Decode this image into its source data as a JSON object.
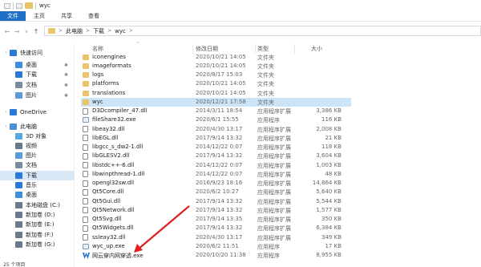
{
  "window": {
    "title": "wyc"
  },
  "ribbon": {
    "tabs": [
      "文件",
      "主页",
      "共享",
      "查看"
    ]
  },
  "address": {
    "crumbs": [
      "此电脑",
      "下载",
      "wyc"
    ],
    "separator": ">"
  },
  "nav": {
    "back": "←",
    "forward": "→",
    "recent": "∨",
    "up": "↑"
  },
  "sidebar": {
    "items": [
      {
        "label": "快速访问",
        "icon": "star-icon",
        "color": "#2b79d6"
      },
      {
        "label": "桌面",
        "icon": "desktop-icon",
        "color": "#3b8fdc",
        "pinned": true
      },
      {
        "label": "下载",
        "icon": "download-icon",
        "color": "#2b79d6",
        "pinned": true
      },
      {
        "label": "文档",
        "icon": "documents-icon",
        "color": "#7a8aa0",
        "pinned": true
      },
      {
        "label": "图片",
        "icon": "pictures-icon",
        "color": "#5a9bd8",
        "pinned": true
      },
      {
        "label": "OneDrive",
        "icon": "cloud-icon",
        "color": "#2b79d6"
      },
      {
        "label": "此电脑",
        "icon": "computer-icon",
        "color": "#4a8fd4"
      },
      {
        "label": "3D 对象",
        "icon": "cube-icon",
        "color": "#58a6e0"
      },
      {
        "label": "视频",
        "icon": "video-icon",
        "color": "#6a7a8c"
      },
      {
        "label": "图片",
        "icon": "pictures-icon",
        "color": "#5a9bd8"
      },
      {
        "label": "文档",
        "icon": "documents-icon",
        "color": "#7a8aa0"
      },
      {
        "label": "下载",
        "icon": "download-icon",
        "color": "#2b79d6",
        "selected": true
      },
      {
        "label": "音乐",
        "icon": "music-icon",
        "color": "#2b79d6"
      },
      {
        "label": "桌面",
        "icon": "desktop-icon",
        "color": "#3b8fdc"
      },
      {
        "label": "本地磁盘 (C:)",
        "icon": "drive-icon",
        "color": "#6a7a8c"
      },
      {
        "label": "新加卷 (D:)",
        "icon": "drive-icon",
        "color": "#6a7a8c"
      },
      {
        "label": "新加卷 (E:)",
        "icon": "drive-icon",
        "color": "#6a7a8c"
      },
      {
        "label": "新加卷 (F:)",
        "icon": "drive-icon",
        "color": "#6a7a8c"
      },
      {
        "label": "新加卷 (G:)",
        "icon": "drive-icon",
        "color": "#6a7a8c"
      }
    ]
  },
  "columns": {
    "name": "名称",
    "date": "修改日期",
    "type": "类型",
    "size": "大小"
  },
  "files": [
    {
      "name": "iconengines",
      "date": "2020/10/21 14:05",
      "type": "文件夹",
      "size": "",
      "kind": "folder"
    },
    {
      "name": "imageformats",
      "date": "2020/10/21 14:05",
      "type": "文件夹",
      "size": "",
      "kind": "folder"
    },
    {
      "name": "logs",
      "date": "2020/8/17 15:03",
      "type": "文件夹",
      "size": "",
      "kind": "folder"
    },
    {
      "name": "platforms",
      "date": "2020/10/21 14:05",
      "type": "文件夹",
      "size": "",
      "kind": "folder"
    },
    {
      "name": "translations",
      "date": "2020/10/21 14:05",
      "type": "文件夹",
      "size": "",
      "kind": "folder"
    },
    {
      "name": "wyc",
      "date": "2020/12/21 17:58",
      "type": "文件夹",
      "size": "",
      "kind": "folder",
      "selected": true
    },
    {
      "name": "D3Dcompiler_47.dll",
      "date": "2014/3/11 18:54",
      "type": "应用程序扩展",
      "size": "3,386 KB",
      "kind": "dll"
    },
    {
      "name": "fileShare32.exe",
      "date": "2020/6/1 15:55",
      "type": "应用程序",
      "size": "116 KB",
      "kind": "exe"
    },
    {
      "name": "libeay32.dll",
      "date": "2020/4/30 13:17",
      "type": "应用程序扩展",
      "size": "2,008 KB",
      "kind": "dll"
    },
    {
      "name": "libEGL.dll",
      "date": "2017/9/14 13:32",
      "type": "应用程序扩展",
      "size": "21 KB",
      "kind": "dll"
    },
    {
      "name": "libgcc_s_dw2-1.dll",
      "date": "2014/12/22 0:07",
      "type": "应用程序扩展",
      "size": "118 KB",
      "kind": "dll"
    },
    {
      "name": "libGLESV2.dll",
      "date": "2017/9/14 13:32",
      "type": "应用程序扩展",
      "size": "3,604 KB",
      "kind": "dll"
    },
    {
      "name": "libstdc++-6.dll",
      "date": "2014/12/22 0:07",
      "type": "应用程序扩展",
      "size": "1,003 KB",
      "kind": "dll"
    },
    {
      "name": "libwinpthread-1.dll",
      "date": "2014/12/22 0:07",
      "type": "应用程序扩展",
      "size": "48 KB",
      "kind": "dll"
    },
    {
      "name": "opengl32sw.dll",
      "date": "2016/9/23 18:16",
      "type": "应用程序扩展",
      "size": "14,864 KB",
      "kind": "dll"
    },
    {
      "name": "Qt5Core.dll",
      "date": "2020/6/2 10:27",
      "type": "应用程序扩展",
      "size": "5,640 KB",
      "kind": "dll"
    },
    {
      "name": "Qt5Gui.dll",
      "date": "2017/9/14 13:32",
      "type": "应用程序扩展",
      "size": "5,544 KB",
      "kind": "dll"
    },
    {
      "name": "Qt5Network.dll",
      "date": "2017/9/14 13:32",
      "type": "应用程序扩展",
      "size": "1,577 KB",
      "kind": "dll"
    },
    {
      "name": "Qt5Svg.dll",
      "date": "2017/9/14 13:35",
      "type": "应用程序扩展",
      "size": "350 KB",
      "kind": "dll"
    },
    {
      "name": "Qt5Widgets.dll",
      "date": "2017/9/14 13:32",
      "type": "应用程序扩展",
      "size": "6,384 KB",
      "kind": "dll"
    },
    {
      "name": "ssleay32.dll",
      "date": "2020/4/30 13:17",
      "type": "应用程序扩展",
      "size": "349 KB",
      "kind": "dll"
    },
    {
      "name": "wyc_up.exe",
      "date": "2020/6/2 11:51",
      "type": "应用程序",
      "size": "17 KB",
      "kind": "exe"
    },
    {
      "name": "网云穿内网穿透.exe",
      "date": "2020/10/20 11:38",
      "type": "应用程序",
      "size": "8,955 KB",
      "kind": "exe-blue"
    }
  ],
  "status": {
    "count": "25 个项目"
  },
  "colors": {
    "accent": "#1f6fc6",
    "selection": "#cce4f7",
    "folder": "#e9c56a",
    "arrow": "#e02020"
  }
}
